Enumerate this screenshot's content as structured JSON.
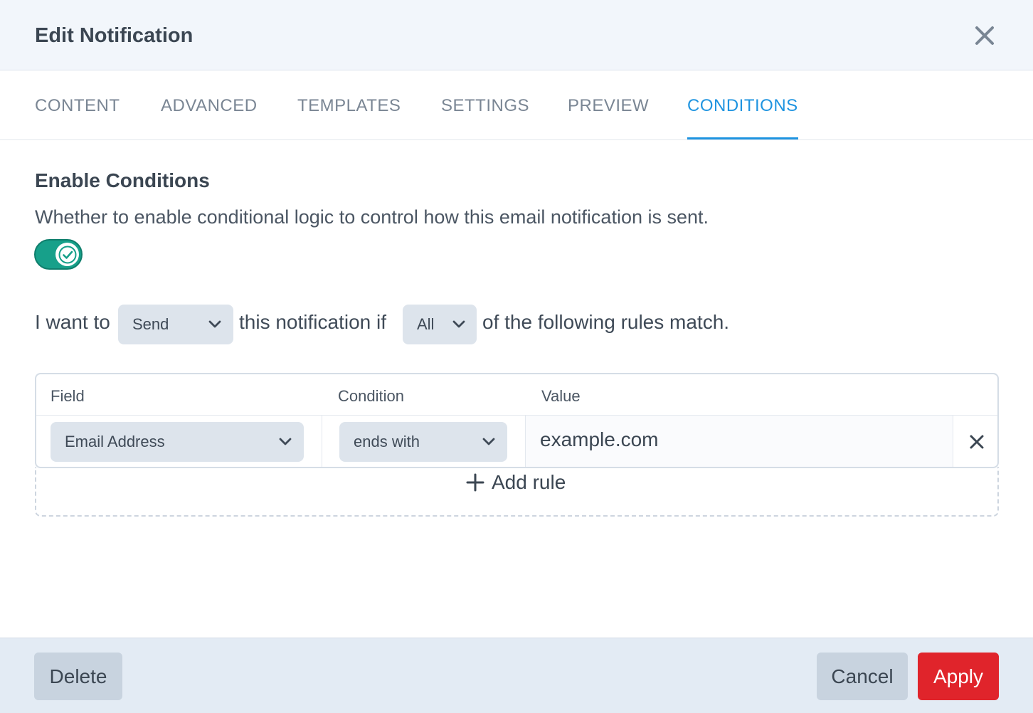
{
  "dialog": {
    "title": "Edit Notification"
  },
  "tabs": [
    {
      "label": "CONTENT",
      "active": false
    },
    {
      "label": "ADVANCED",
      "active": false
    },
    {
      "label": "TEMPLATES",
      "active": false
    },
    {
      "label": "SETTINGS",
      "active": false
    },
    {
      "label": "PREVIEW",
      "active": false
    },
    {
      "label": "CONDITIONS",
      "active": true
    }
  ],
  "conditions": {
    "title": "Enable Conditions",
    "description": "Whether to enable conditional logic to control how this email notification is sent.",
    "enabled": true,
    "sentence": {
      "prefix": "I want to",
      "action": "Send",
      "middle": "this notification if",
      "match": "All",
      "suffix": "of the following rules match."
    },
    "table": {
      "headers": {
        "field": "Field",
        "condition": "Condition",
        "value": "Value"
      },
      "rows": [
        {
          "field": "Email Address",
          "condition": "ends with",
          "value": "example.com"
        }
      ],
      "add_rule_label": "Add rule"
    }
  },
  "footer": {
    "delete_label": "Delete",
    "cancel_label": "Cancel",
    "apply_label": "Apply"
  },
  "colors": {
    "accent": "#1f94e0",
    "toggle_on": "#17a08a",
    "danger": "#e0242b"
  },
  "icons": {
    "close": "close-icon",
    "toggle_check": "check-icon",
    "select_chevron": "chevron-down-icon",
    "remove_rule": "close-icon",
    "add_rule": "plus-icon"
  }
}
